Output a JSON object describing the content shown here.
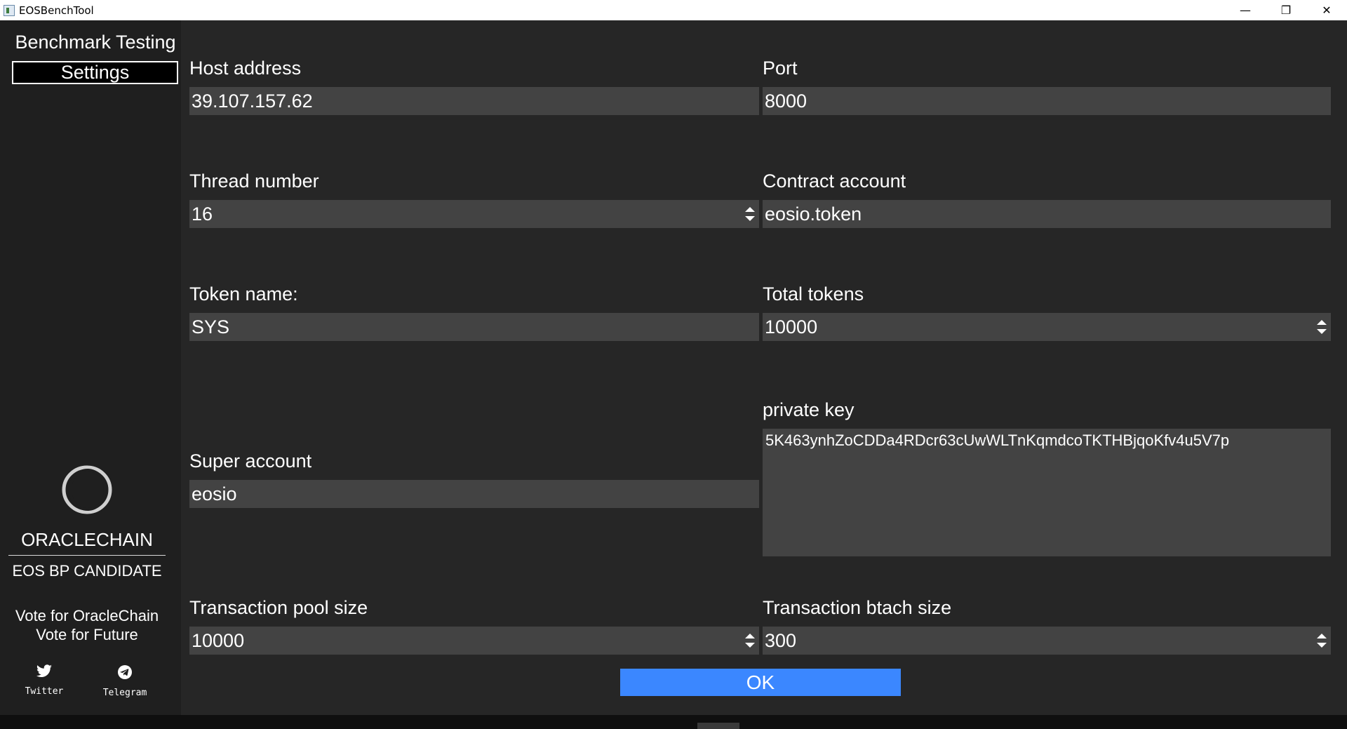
{
  "window": {
    "title": "EOSBenchTool",
    "minimize": "—",
    "restore": "❐",
    "close": "✕"
  },
  "sidebar": {
    "nav_benchmark": "Benchmark Testing",
    "nav_settings": "Settings",
    "brand_name": "ORACLECHAIN",
    "brand_sub": "EOS BP CANDIDATE",
    "vote_line1": "Vote for OracleChain",
    "vote_line2": "Vote for Future",
    "twitter_label": "Twitter",
    "telegram_label": "Telegram"
  },
  "form": {
    "host_label": "Host address",
    "host_value": "39.107.157.62",
    "port_label": "Port",
    "port_value": "8000",
    "thread_label": "Thread number",
    "thread_value": "16",
    "contract_label": "Contract account",
    "contract_value": "eosio.token",
    "token_label": "Token name:",
    "token_value": "SYS",
    "total_label": "Total tokens",
    "total_value": "10000",
    "privkey_label": "private key",
    "privkey_value": "5K463ynhZoCDDa4RDcr63cUwWLTnKqmdcoTKTHBjqoKfv4u5V7p",
    "super_label": "Super account",
    "super_value": "eosio",
    "pool_label": "Transaction pool size",
    "pool_value": "10000",
    "batch_label": "Transaction btach size",
    "batch_value": "300",
    "ok_label": "OK"
  },
  "colors": {
    "accent": "#3b87ff",
    "panel": "#262626",
    "input": "#434343"
  }
}
